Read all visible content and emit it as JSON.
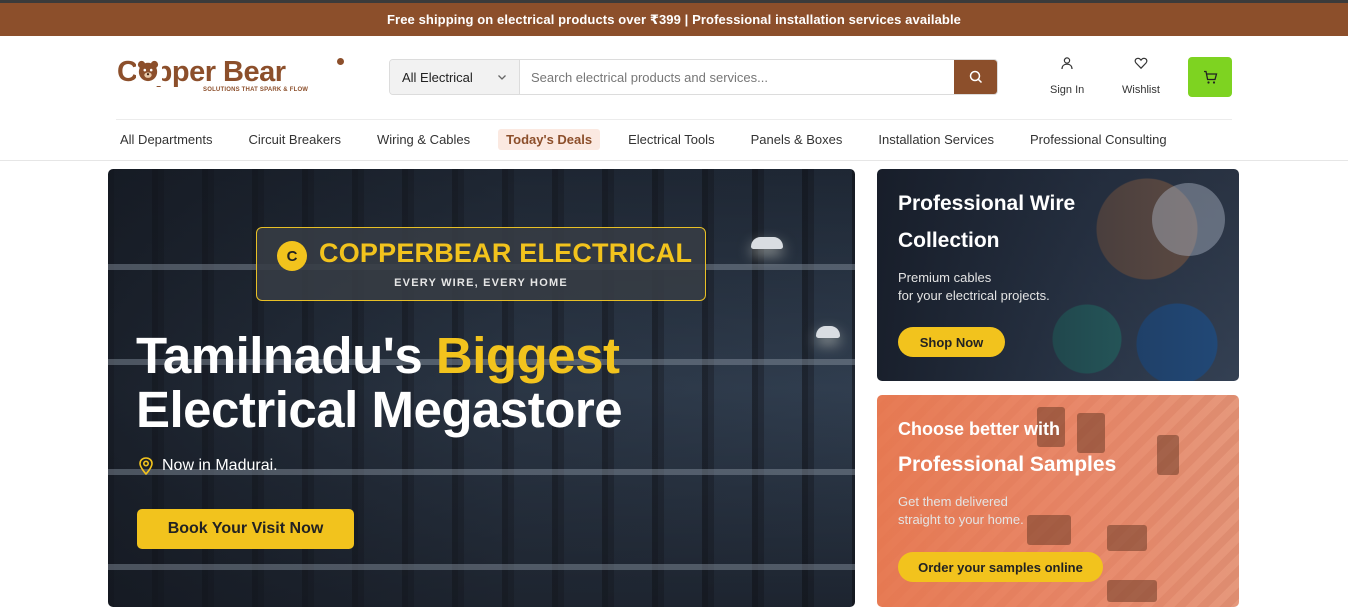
{
  "announcement": "Free shipping on electrical products over ₹399 | Professional installation services available",
  "logo": {
    "name": "Copper Bear",
    "tagline": "SOLUTIONS THAT SPARK & FLOW"
  },
  "search": {
    "category": "All Electrical",
    "placeholder": "Search electrical products and services...",
    "value": ""
  },
  "header_actions": {
    "sign_in": "Sign In",
    "wishlist": "Wishlist"
  },
  "nav": [
    {
      "label": "All Departments",
      "highlight": false
    },
    {
      "label": "Circuit Breakers",
      "highlight": false
    },
    {
      "label": "Wiring & Cables",
      "highlight": false
    },
    {
      "label": "Today's Deals",
      "highlight": true
    },
    {
      "label": "Electrical Tools",
      "highlight": false
    },
    {
      "label": "Panels & Boxes",
      "highlight": false
    },
    {
      "label": "Installation Services",
      "highlight": false
    },
    {
      "label": "Professional Consulting",
      "highlight": false
    }
  ],
  "hero": {
    "badge_letter": "C",
    "badge_title": "COPPERBEAR ELECTRICAL",
    "badge_subtitle": "EVERY WIRE, EVERY HOME",
    "headline_part1": "Tamilnadu's ",
    "headline_highlight": "Biggest",
    "headline_part2": "Electrical Megastore",
    "location": "Now in Madurai.",
    "cta": "Book Your Visit Now"
  },
  "promo_cards": [
    {
      "title_line1": "Professional Wire",
      "title_line2": "Collection",
      "text_line1": "Premium cables",
      "text_line2": "for your electrical projects.",
      "button": "Shop Now"
    },
    {
      "title_line1": "Choose better with",
      "title_line2": "Professional Samples",
      "text_line1": "Get them delivered",
      "text_line2": "straight to your home.",
      "button": "Order your samples online"
    }
  ],
  "colors": {
    "brand": "#8c4f2b",
    "accent_yellow": "#f2c31d",
    "cart_green": "#7ed321",
    "deal_bg": "#fbe9e1"
  },
  "icons": {
    "search": "search-icon",
    "user": "user-icon",
    "wishlist": "heart-icon",
    "cart": "cart-icon",
    "location": "map-pin-icon",
    "dropdown": "chevron-down-icon"
  }
}
